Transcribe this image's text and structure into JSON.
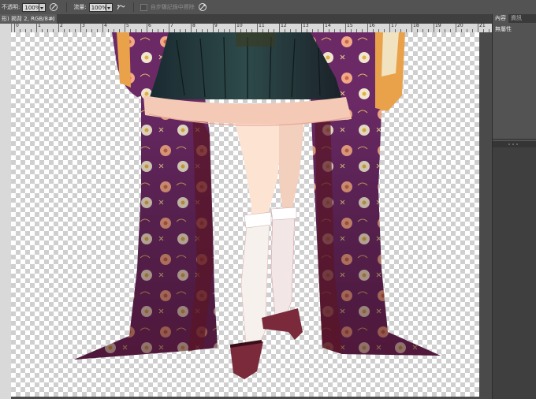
{
  "options_bar": {
    "opacity_label": "不透明:",
    "opacity_value": "100%",
    "flow_label": "流量:",
    "flow_value": "100%",
    "history_label": "自步驟記錄中擦除"
  },
  "document_tab": {
    "title": "形) 揭背 2, RGB/8#) *",
    "close": "×"
  },
  "ruler": {
    "ticks": [
      "0",
      "1",
      "2",
      "3",
      "4",
      "5",
      "6",
      "7",
      "8",
      "9",
      "10",
      "11",
      "12",
      "13",
      "14",
      "15",
      "16",
      "17",
      "18",
      "19",
      "20",
      "21"
    ]
  },
  "panel": {
    "tabs": [
      "內容",
      "資訊"
    ],
    "no_properties": "無屬性"
  },
  "colors": {
    "kimono_purple": "#6b2a66",
    "kimono_wine": "#5a1625",
    "skirt_dark": "#1f2e33",
    "skirt_frill": "#f4c9b6",
    "skin": "#fde3d2",
    "flower_pink": "#f2a887",
    "shoe": "#7a2a3a"
  },
  "icons": [
    "brush-pressure-icon",
    "airbrush-icon",
    "tablet-pressure-icon"
  ]
}
